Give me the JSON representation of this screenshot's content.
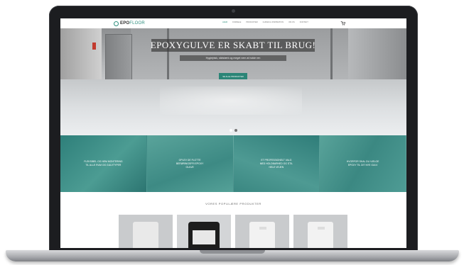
{
  "site": {
    "logo": {
      "brand": "EPO",
      "accent": "FLOOR"
    },
    "nav": [
      "Hjem",
      "Fordele",
      "Produkter",
      "Guides & inspiration",
      "Om os",
      "Kontakt"
    ],
    "active_nav_index": 0,
    "cart_icon": "cart-icon"
  },
  "hero": {
    "title": "EPOXYGULVE ER SKABT TIL BRUG!",
    "subtitle": "Hygiejnisk, slidstærk og meget nem at holde ren",
    "cta": "Se alle produkter",
    "slide_count": 2,
    "active_slide": 0
  },
  "features": [
    "Fleksibel og nem montering\ntil alle rum og gulvtyper",
    "Oplev de flotte\nberøringsfri epoxy\ngulve",
    "Et professionelt valg\nmed holdbarhed og stil\nhele vejen",
    "Hvorfor skal du vælge\nepoxy til dit nye gulv"
  ],
  "products": {
    "title": "Vores populære produkter"
  },
  "colors": {
    "accent": "#2b8577",
    "feature_band": "#3e8d87",
    "laptop_bezel": "#1c1d20"
  }
}
